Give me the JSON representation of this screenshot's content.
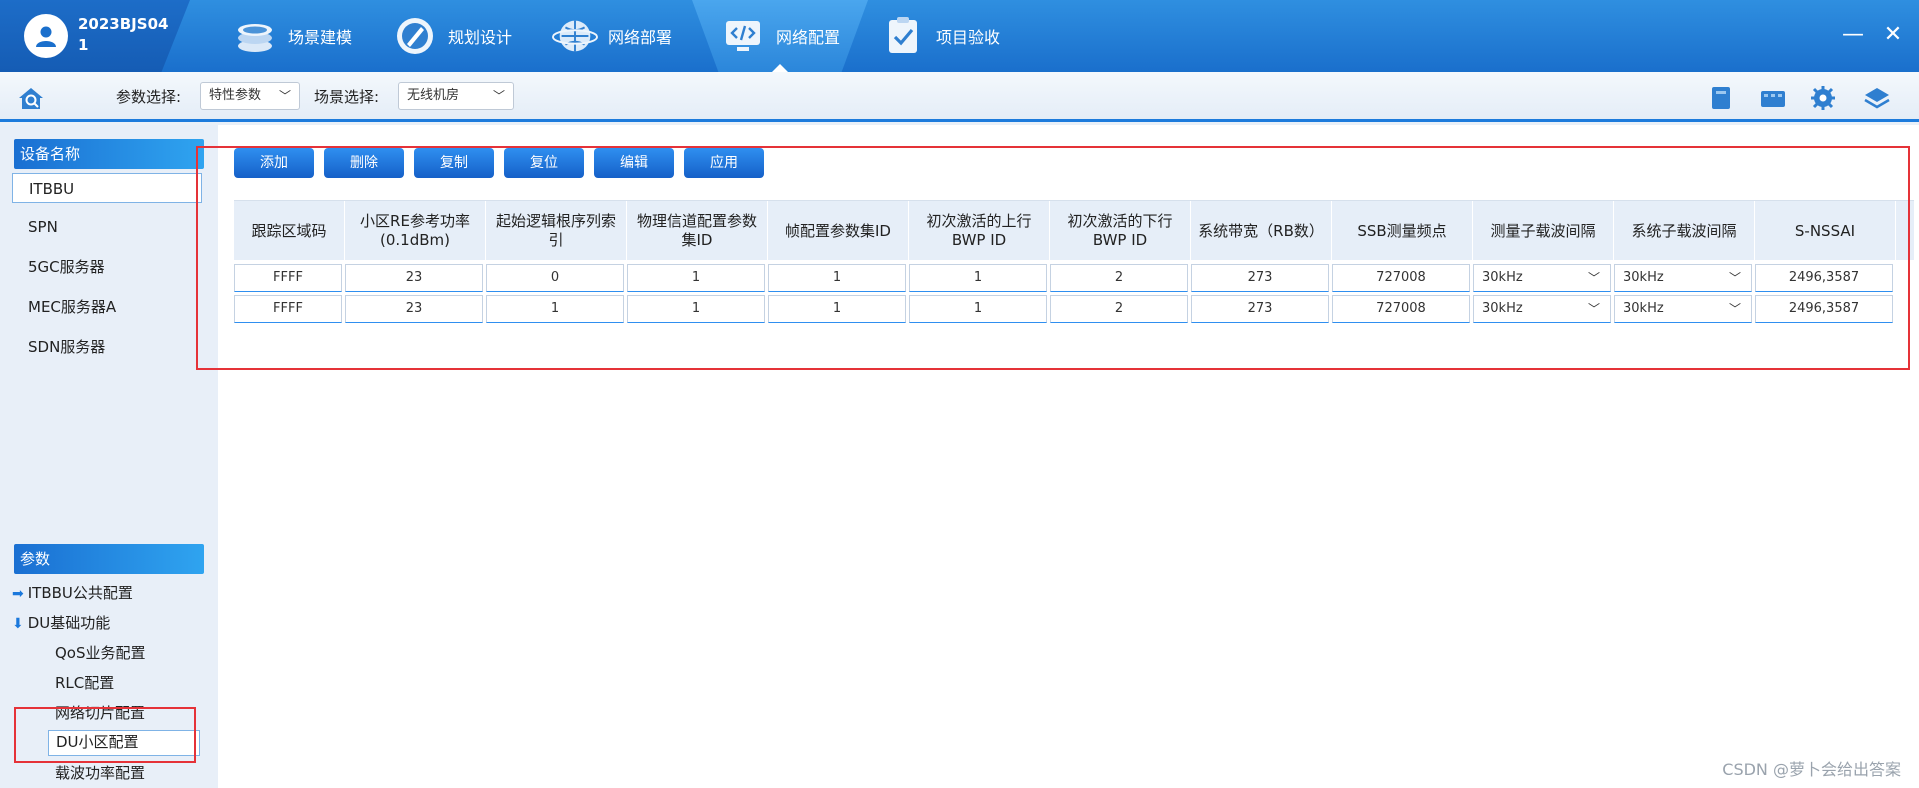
{
  "titlebar": {
    "username": "2023BJS041",
    "tabs": [
      {
        "label": "场景建模",
        "icon": "stack-layers-icon"
      },
      {
        "label": "规划设计",
        "icon": "compass-pencil-icon"
      },
      {
        "label": "网络部署",
        "icon": "globe-icon"
      },
      {
        "label": "网络配置",
        "icon": "code-monitor-icon",
        "active": true
      },
      {
        "label": "项目验收",
        "icon": "checklist-icon"
      }
    ],
    "minimize": "—",
    "close": "✕"
  },
  "toolbar": {
    "param_label": "参数选择:",
    "param_value": "特性参数",
    "scene_label": "场景选择:",
    "scene_value": "无线机房"
  },
  "left": {
    "device_header": "设备名称",
    "devices": [
      "ITBBU",
      "SPN",
      "5GC服务器",
      "MEC服务器A",
      "SDN服务器"
    ],
    "selected_device": "ITBBU",
    "param_header": "参数",
    "params": [
      {
        "label": "ITBBU公共配置",
        "expanded": false
      },
      {
        "label": "DU基础功能",
        "expanded": true
      }
    ],
    "sub_params": [
      "QoS业务配置",
      "RLC配置",
      "网络切片配置",
      "DU小区配置",
      "载波功率配置"
    ],
    "selected_sub": "DU小区配置"
  },
  "actions": [
    "添加",
    "删除",
    "复制",
    "复位",
    "编辑",
    "应用"
  ],
  "table": {
    "columns": [
      "跟踪区域码",
      "小区RE参考功率(0.1dBm)",
      "起始逻辑根序列索引",
      "物理信道配置参数集ID",
      "帧配置参数集ID",
      "初次激活的上行BWP ID",
      "初次激活的下行BWP ID",
      "系统带宽（RB数）",
      "SSB测量频点",
      "测量子载波间隔",
      "系统子载波间隔",
      "S-NSSAI"
    ],
    "rows": [
      [
        "FFFF",
        "23",
        "0",
        "1",
        "1",
        "1",
        "2",
        "273",
        "727008",
        "30kHz",
        "30kHz",
        "2496,3587"
      ],
      [
        "FFFF",
        "23",
        "1",
        "1",
        "1",
        "1",
        "2",
        "273",
        "727008",
        "30kHz",
        "30kHz",
        "2496,3587"
      ]
    ]
  },
  "watermark": "CSDN @萝卜会给出答案",
  "colors": {
    "accent": "#1c7bdc",
    "annotation": "#e53238"
  }
}
